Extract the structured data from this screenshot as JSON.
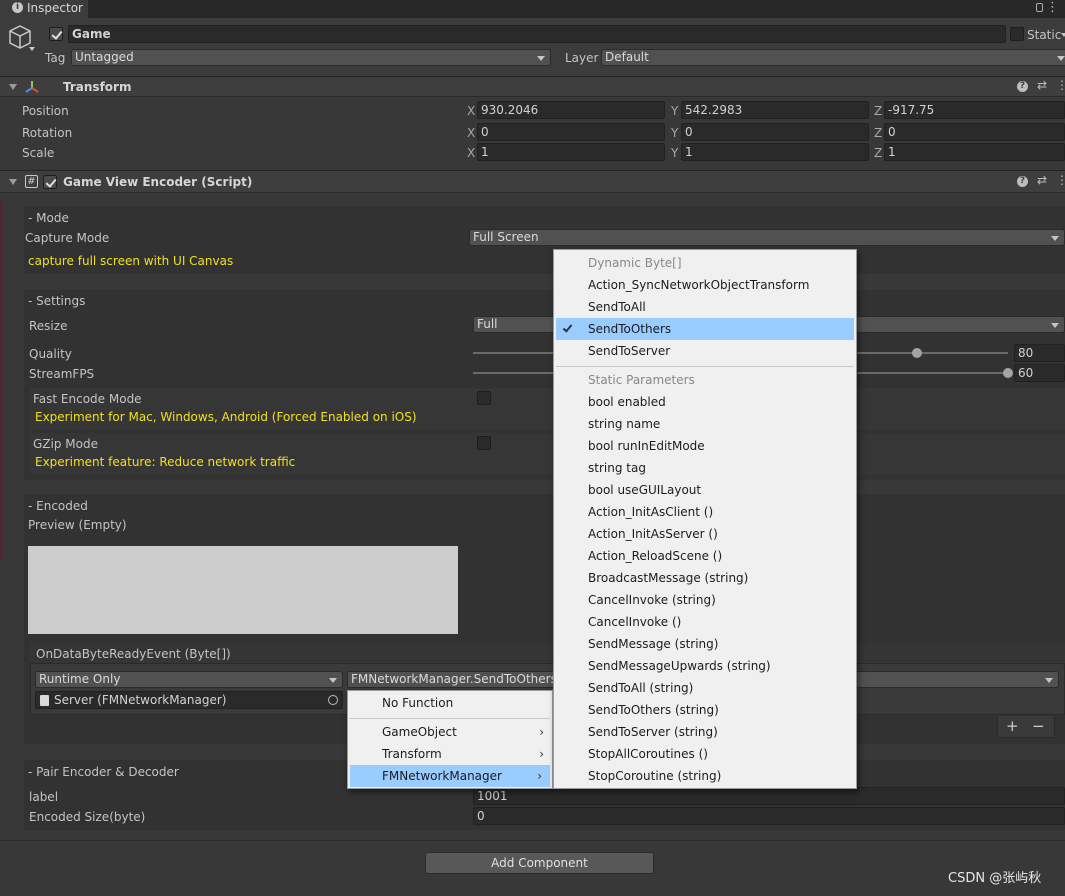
{
  "tab": {
    "icon": "info-icon",
    "title": "Inspector",
    "menu_icon": "kebab-menu-icon"
  },
  "gameobject": {
    "active": true,
    "name": "Game",
    "static_label": "Static",
    "tag_label": "Tag",
    "tag_value": "Untagged",
    "layer_label": "Layer",
    "layer_value": "Default"
  },
  "transform": {
    "title": "Transform",
    "position_label": "Position",
    "rotation_label": "Rotation",
    "scale_label": "Scale",
    "axis_x": "X",
    "axis_y": "Y",
    "axis_z": "Z",
    "position": [
      "930.2046",
      "542.2983",
      "-917.75"
    ],
    "rotation": [
      "0",
      "0",
      "0"
    ],
    "scale": [
      "1",
      "1",
      "1"
    ]
  },
  "encoder": {
    "title": "Game View Encoder (Script)",
    "enabled": true,
    "mode_section": "- Mode",
    "capture_mode_label": "Capture Mode",
    "capture_mode_value": "Full Screen",
    "capture_hint": "capture full screen with UI Canvas",
    "settings_section": "- Settings",
    "resize_label": "Resize",
    "resize_value": "Full",
    "quality_label": "Quality",
    "quality_value": "80",
    "quality_level": 0.83,
    "streamfps_label": "StreamFPS",
    "streamfps_value": "60",
    "streamfps_level": 1.0,
    "fast_encode_label": "Fast Encode Mode",
    "fast_encode_hint": "Experiment for Mac, Windows, Android (Forced Enabled on iOS)",
    "gzip_label": "GZip Mode",
    "gzip_hint": "Experiment feature: Reduce network traffic",
    "encoded_section": "- Encoded",
    "preview_label": "Preview (Empty)",
    "event_title": "OnDataByteReadyEvent (Byte[])",
    "runtime_value": "Runtime Only",
    "function_value": "FMNetworkManager.SendToOthers",
    "target_object": "Server (FMNetworkManager)",
    "add_btn": "+",
    "remove_btn": "−",
    "pair_section": "- Pair Encoder & Decoder",
    "label_label": "label",
    "label_value": "1001",
    "encoded_size_label": "Encoded Size(byte)",
    "encoded_size_value": "0"
  },
  "add_component": "Add Component",
  "watermark": "CSDN @张屿秋",
  "context_menu": {
    "items": [
      "No Function",
      "GameObject",
      "Transform",
      "FMNetworkManager"
    ],
    "arrow": "›"
  },
  "function_menu": {
    "dynamic_header": "Dynamic Byte[]",
    "dynamic_items": [
      "Action_SyncNetworkObjectTransform",
      "SendToAll",
      "SendToOthers",
      "SendToServer"
    ],
    "selected": "SendToOthers",
    "static_header": "Static Parameters",
    "static_items": [
      "bool enabled",
      "string name",
      "bool runInEditMode",
      "string tag",
      "bool useGUILayout",
      "Action_InitAsClient ()",
      "Action_InitAsServer ()",
      "Action_ReloadScene ()",
      "BroadcastMessage (string)",
      "CancelInvoke (string)",
      "CancelInvoke ()",
      "SendMessage (string)",
      "SendMessageUpwards (string)",
      "SendToAll (string)",
      "SendToOthers (string)",
      "SendToServer (string)",
      "StopAllCoroutines ()",
      "StopCoroutine (string)"
    ]
  },
  "colors": {
    "highlight": "#99ccff",
    "hint_yellow": "#f0e020",
    "panel": "#383838"
  }
}
